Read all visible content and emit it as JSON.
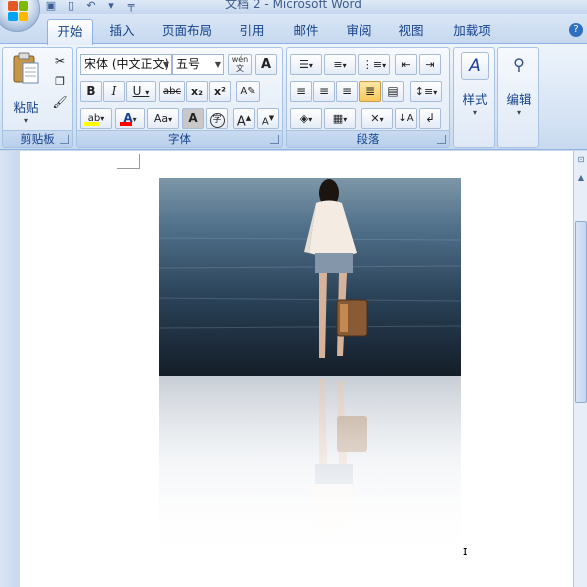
{
  "window": {
    "title": "文档 2 - Microsoft Word"
  },
  "quick_access": {
    "save": "save-icon",
    "new": "new-doc-icon",
    "undo": "undo-icon",
    "customize": "dropdown-icon"
  },
  "tabs": [
    "开始",
    "插入",
    "页面布局",
    "引用",
    "邮件",
    "审阅",
    "视图",
    "加载项"
  ],
  "active_tab": "开始",
  "groups": {
    "clipboard": {
      "label": "剪贴板",
      "paste": "粘贴"
    },
    "font": {
      "label": "字体",
      "font_name": "宋体 (中文正文)",
      "font_size": "五号",
      "phonetic": "wén",
      "bold": "B",
      "italic": "I",
      "underline": "U",
      "strike": "abc",
      "sub": "x₂",
      "sup": "x²",
      "case": "Aa",
      "grow": "A",
      "shrink": "A",
      "highlight_color": "#ffff00",
      "font_color": "#ff0000",
      "enclosed": "字"
    },
    "paragraph": {
      "label": "段落"
    },
    "styles": {
      "label": "样式"
    },
    "editing": {
      "label": "编辑"
    }
  },
  "colors": {
    "accent": "#15428b",
    "ribbon": "#dfe9f6"
  }
}
